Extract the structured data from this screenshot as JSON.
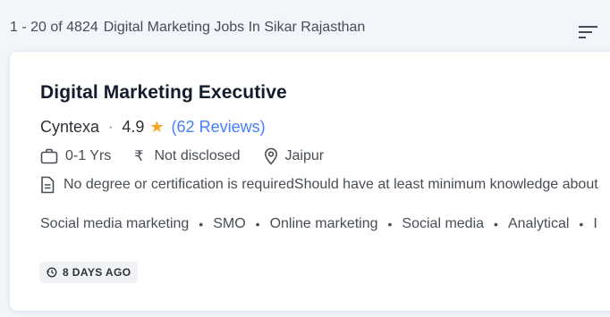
{
  "results": {
    "count_text": "1 - 20 of 4824",
    "title_text": "Digital Marketing Jobs In Sikar Rajasthan"
  },
  "job": {
    "title": "Digital Marketing Executive",
    "company": "Cyntexa",
    "separator": "·",
    "rating": "4.9",
    "star_glyph": "★",
    "reviews": "(62 Reviews)",
    "experience": "0-1 Yrs",
    "rupee_glyph": "₹",
    "salary": "Not disclosed",
    "location": "Jaipur",
    "description": "No degree or certification is requiredShould have at least minimum knowledge about",
    "tags": [
      "Social media marketing",
      "SMO",
      "Online marketing",
      "Social media",
      "Analytical",
      "I"
    ],
    "posted": "8 DAYS AGO"
  },
  "icons": {
    "sort": "sort-icon",
    "experience": "briefcase-icon",
    "location": "location-pin-icon",
    "description": "document-icon",
    "posted": "clock-icon"
  },
  "colors": {
    "page_bg": "#f2f5fa",
    "card_bg": "#ffffff",
    "title": "#121c2d",
    "link": "#457eff",
    "star": "#f5a623",
    "badge_bg": "#f0f2f5"
  }
}
